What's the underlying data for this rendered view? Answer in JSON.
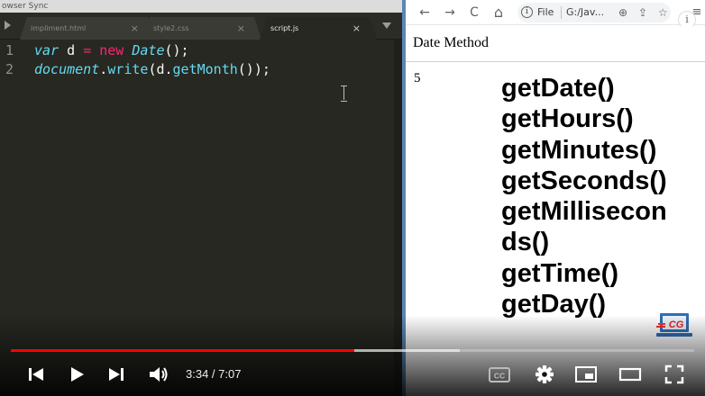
{
  "editor": {
    "window_title": "owser Sync",
    "tabs": [
      {
        "label": "impliment.html",
        "close": "×",
        "active": false
      },
      {
        "label": "style2.css",
        "close": "×",
        "active": false
      },
      {
        "label": "script.js",
        "close": "×",
        "active": true
      }
    ],
    "lines": [
      {
        "number": "1",
        "tokens": [
          {
            "text": "var",
            "kind": "kw-i"
          },
          {
            "text": " d ",
            "kind": "plain"
          },
          {
            "text": "=",
            "kind": "kw"
          },
          {
            "text": " ",
            "kind": "plain"
          },
          {
            "text": "new",
            "kind": "kw"
          },
          {
            "text": " ",
            "kind": "plain"
          },
          {
            "text": "Date",
            "kind": "cls"
          },
          {
            "text": "();",
            "kind": "plain"
          }
        ]
      },
      {
        "number": "2",
        "tokens": [
          {
            "text": "document",
            "kind": "cls"
          },
          {
            "text": ".",
            "kind": "plain"
          },
          {
            "text": "write",
            "kind": "fn"
          },
          {
            "text": "(d.",
            "kind": "plain"
          },
          {
            "text": "getMonth",
            "kind": "fn"
          },
          {
            "text": "());",
            "kind": "plain"
          }
        ]
      }
    ]
  },
  "browser": {
    "nav": {
      "back": "←",
      "forward": "→",
      "reload": "C",
      "home": "⌂"
    },
    "address": {
      "info": "i",
      "scheme_label": "File",
      "url": "G:/Jav..."
    },
    "address_icons": {
      "zoom": "⊕",
      "share": "⇪",
      "bookmark": "☆"
    },
    "menu": "≡",
    "profile": "i",
    "page": {
      "heading": "Date Method",
      "output": "5",
      "methods": [
        "getDate()",
        "getHours()",
        "getMinutes()",
        "getSeconds()",
        "getMillisecon",
        "ds()",
        "getTime()",
        "getDay()"
      ]
    },
    "logo_text": "CG"
  },
  "player": {
    "current_time": "3:34",
    "separator": " / ",
    "duration": "7:07",
    "progress_fraction": 0.502,
    "buffer_fraction": 0.657,
    "cc_label": "CC",
    "colors": {
      "played": "#ff0000",
      "editor_bg": "#272822"
    }
  }
}
